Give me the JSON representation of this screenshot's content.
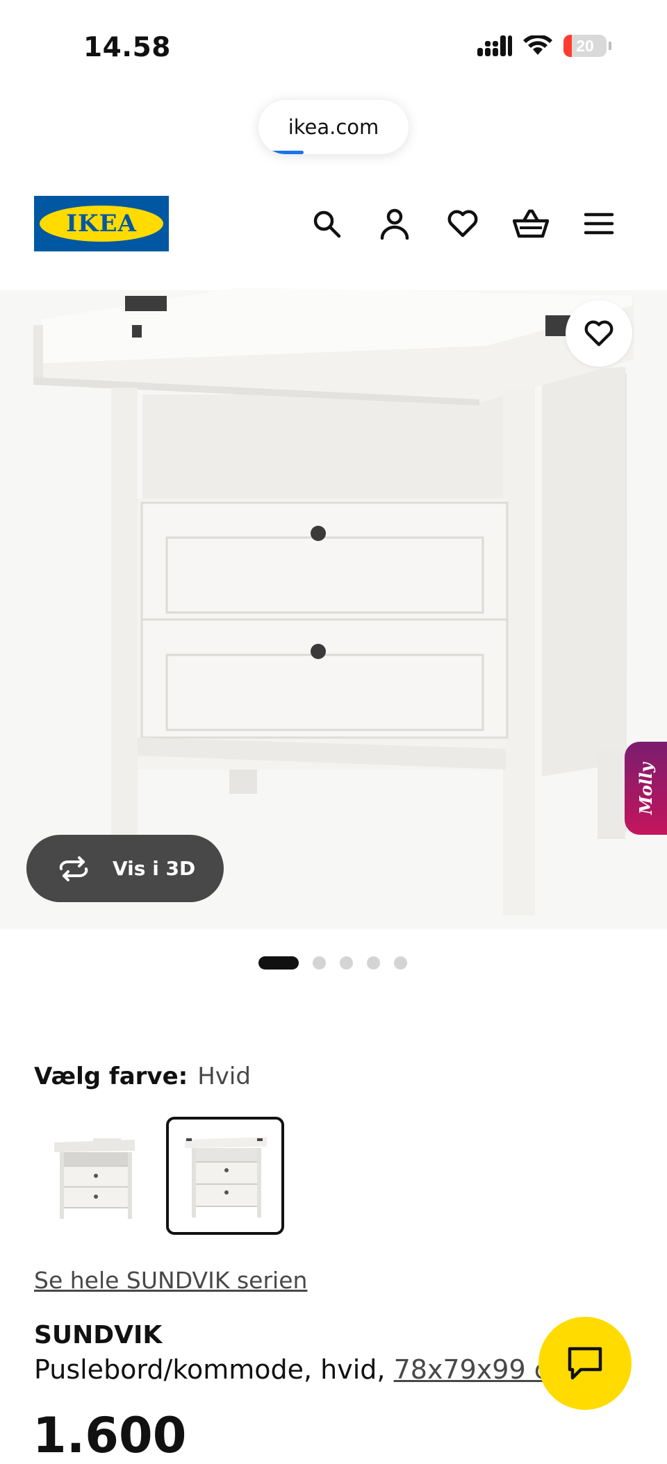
{
  "status_bar": {
    "time": "14.58",
    "battery_level": "20",
    "battery_fraction": 0.2,
    "icons": [
      "signal-icon",
      "wifi-icon",
      "battery-icon"
    ]
  },
  "browser": {
    "url": "ikea.com",
    "load_progress": 0.3
  },
  "header": {
    "logo_text": "IKEA",
    "logo_colors": {
      "blue": "#0058a3",
      "yellow": "#ffdb00"
    },
    "nav_icons": [
      "search-icon",
      "user-icon",
      "heart-icon",
      "basket-icon",
      "menu-icon"
    ]
  },
  "gallery": {
    "view_3d_label": "Vis i 3D",
    "favorite_icon": "heart-icon",
    "assistant_label": "Molly",
    "image_count": 5,
    "active_index": 0
  },
  "color_selector": {
    "label": "Vælg farve:",
    "value": "Hvid",
    "options": [
      "option-1",
      "option-2"
    ],
    "selected_index": 1
  },
  "product": {
    "series_link": "Se hele SUNDVIK serien",
    "name": "SUNDVIK",
    "description": "Puslebord/kommode, hvid,",
    "dimensions": "78x79x99 cm",
    "price": "1.600"
  },
  "chat_button": {
    "icon": "chat-icon",
    "color": "#ffdb00"
  }
}
